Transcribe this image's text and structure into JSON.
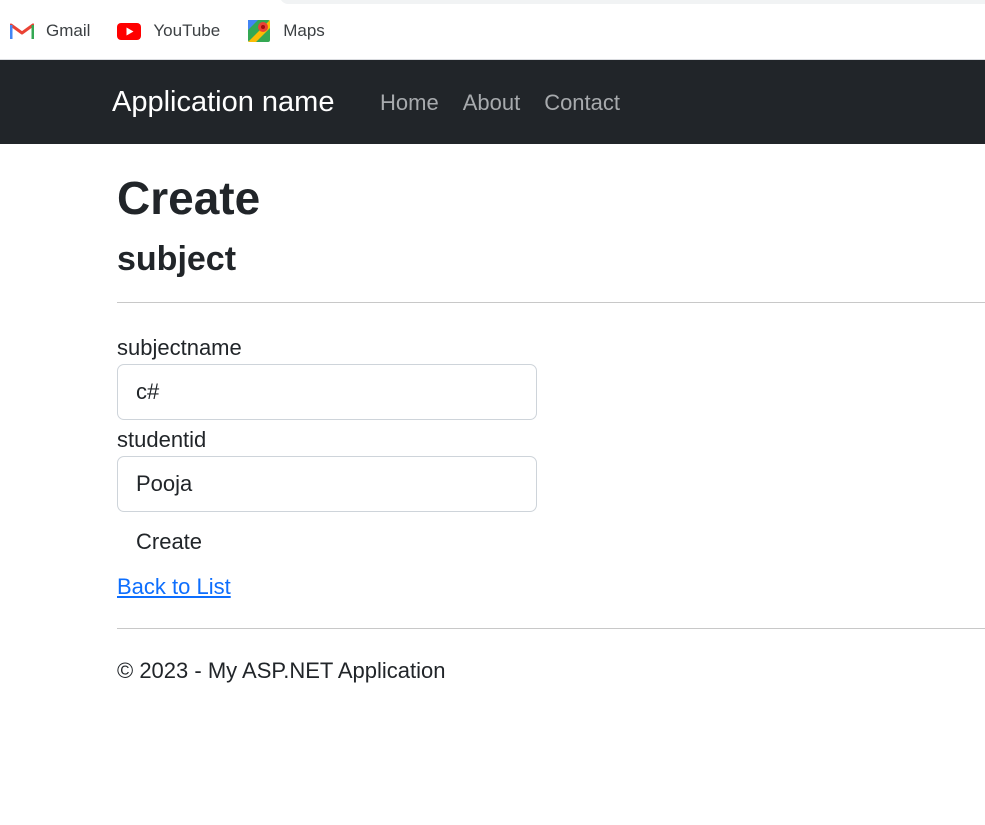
{
  "bookmarks": [
    {
      "label": "Gmail",
      "icon": "gmail-icon"
    },
    {
      "label": "YouTube",
      "icon": "youtube-icon"
    },
    {
      "label": "Maps",
      "icon": "maps-icon"
    }
  ],
  "navbar": {
    "brand": "Application name",
    "links": [
      "Home",
      "About",
      "Contact"
    ],
    "background": "#212529"
  },
  "page": {
    "title": "Create",
    "subtitle": "subject"
  },
  "form": {
    "subjectname_label": "subjectname",
    "subjectname_value": "c#",
    "studentid_label": "studentid",
    "studentid_value": "Pooja",
    "submit_label": "Create"
  },
  "links": {
    "back": "Back to List"
  },
  "footer": {
    "text": "© 2023 - My ASP.NET Application"
  },
  "colors": {
    "link": "#0d6efd",
    "nav_text": "#a7aaad"
  }
}
